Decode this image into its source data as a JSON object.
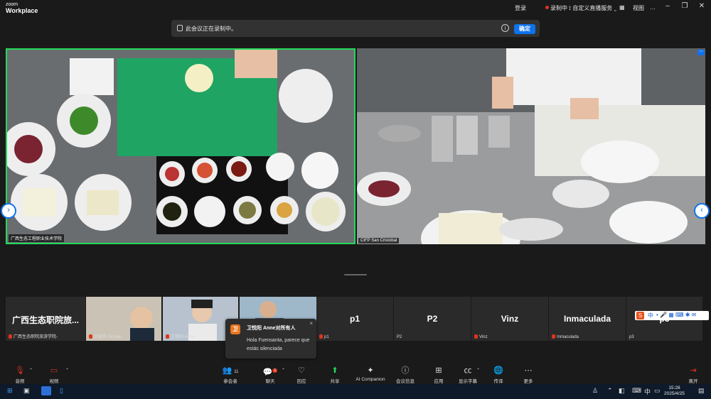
{
  "app": {
    "brand_line1": "zoom",
    "brand_line2": "Workplace"
  },
  "titlebar": {
    "login": "登录",
    "recording": "录制中",
    "livestream": "自定义直播服务",
    "view": "视图",
    "more": "…"
  },
  "banner": {
    "text": "此会议正在录制中。",
    "ok": "确定",
    "info": "i"
  },
  "tiles": {
    "left_name": "广西生态工程职业技术学院",
    "right_name": "CIFP San Cristobal"
  },
  "gallery": [
    {
      "big": "广西生态职院旅...",
      "small": "广西生态职院旅游学院-",
      "muted": true,
      "video": false
    },
    {
      "big": "",
      "small": "邱骏伟 Nicolás",
      "muted": true,
      "video": true
    },
    {
      "big": "",
      "small": "卫悦阳 Anne",
      "muted": true,
      "video": true
    },
    {
      "big": "",
      "small": "",
      "muted": false,
      "video": true
    },
    {
      "big": "p1",
      "small": "p1",
      "muted": true,
      "video": false
    },
    {
      "big": "P2",
      "small": "P2",
      "muted": false,
      "video": false
    },
    {
      "big": "Vinz",
      "small": "Vinz",
      "muted": true,
      "video": false
    },
    {
      "big": "Inmaculada",
      "small": "Inmaculada",
      "muted": true,
      "video": false
    },
    {
      "big": "p3",
      "small": "p3",
      "muted": false,
      "video": false
    }
  ],
  "chat_popup": {
    "avatar": "卫",
    "from": "卫悦阳 Anne对所有人",
    "message": "Hola Fuensanta, parece que estás silenciada",
    "close": "×"
  },
  "toolbar": {
    "audio": "音频",
    "video": "视频",
    "participants": "参会者",
    "participants_count": "11",
    "chat": "聊天",
    "chat_badge": "1",
    "react": "回应",
    "share": "共享",
    "ai": "AI Companion",
    "info": "会议信息",
    "apps": "应用",
    "captions": "显示字幕",
    "translate": "传译",
    "more": "更多",
    "leave": "离开"
  },
  "taskbar": {
    "time": "15:28",
    "date": "2025/4/25",
    "lang": "中"
  },
  "ime": {
    "label": "中"
  },
  "colors": {
    "accent": "#0e72ed",
    "active_border": "#23d959",
    "danger": "#e0341d"
  }
}
